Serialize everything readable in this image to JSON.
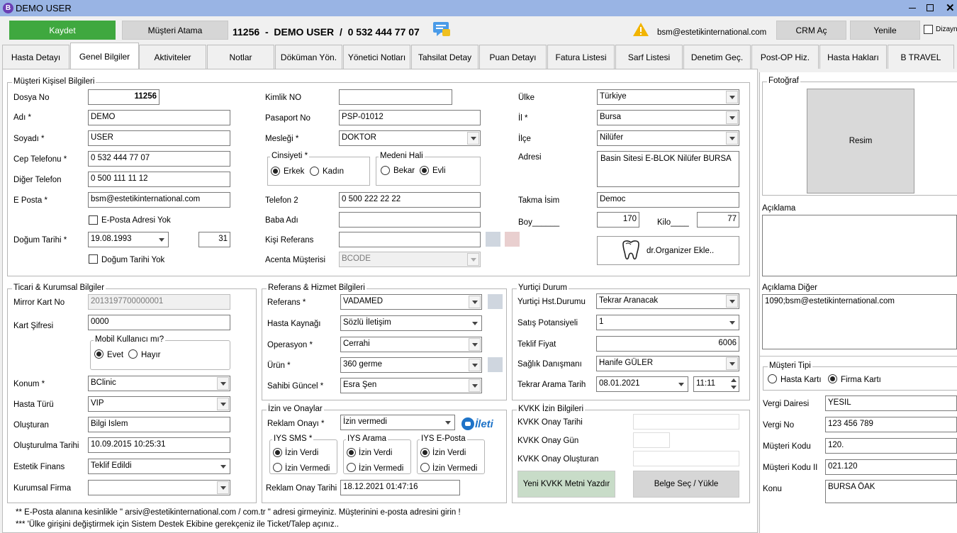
{
  "window": {
    "title": "DEMO USER"
  },
  "toolbar": {
    "save": "Kaydet",
    "assign": "Müşteri Atama",
    "patient_info": "11256  -  DEMO USER  /  0 532 444 77 07",
    "email": "bsm@estetikinternational.com",
    "crm": "CRM Aç",
    "refresh": "Yenile",
    "design": "Dizayn"
  },
  "tabs": [
    "Hasta Detayı",
    "Genel Bilgiler",
    "Aktiviteler",
    "Notlar",
    "Döküman Yön.",
    "Yönetici Notları",
    "Tahsilat Detay",
    "Puan Detayı",
    "Fatura Listesi",
    "Sarf Listesi",
    "Denetim Geç.",
    "Post-OP Hiz.",
    "Hasta Hakları",
    "B TRAVEL"
  ],
  "personal": {
    "legend": "Müşteri Kişisel Bilgileri",
    "dosya_label": "Dosya No",
    "dosya": "11256",
    "adi_label": "Adı *",
    "adi": "DEMO",
    "soyadi_label": "Soyadı *",
    "soyadi": "USER",
    "cep_label": "Cep Telefonu *",
    "cep": "0 532 444 77 07",
    "diger_label": "Diğer Telefon",
    "diger": "0 500 111 11 12",
    "eposta_label": "E Posta *",
    "eposta": "bsm@estetikinternational.com",
    "eposta_yok": "E-Posta Adresi Yok",
    "dogum_label": "Doğum Tarihi *",
    "dogum": "19.08.1993",
    "yas": "31",
    "dogum_yok": "Doğum Tarihi Yok",
    "kimlik_label": "Kimlik NO",
    "kimlik": "",
    "pasaport_label": "Pasaport No",
    "pasaport": "PSP-01012",
    "meslek_label": "Mesleği *",
    "meslek": "DOKTOR",
    "cinsiyet_legend": "Cinsiyeti  *",
    "erkek": "Erkek",
    "kadin": "Kadın",
    "medeni_legend": "Medeni Hali",
    "bekar": "Bekar",
    "evli": "Evli",
    "telefon2_label": "Telefon 2",
    "telefon2": "0 500 222 22 22",
    "baba_label": "Baba Adı",
    "baba": "",
    "kisiref_label": "Kişi Referans",
    "kisiref": "",
    "acenta_label": "Acenta Müşterisi",
    "acenta": "BCODE",
    "ulke_label": "Ülke",
    "ulke": "Türkiye",
    "il_label": "İl *",
    "il": "Bursa",
    "ilce_label": "İlçe",
    "ilce": "Nilüfer",
    "adres_label": "Adresi",
    "adres": "Basin Sitesi E-BLOK Nilüfer BURSA",
    "takma_label": "Takma İsim",
    "takma": "Democ",
    "boy_label": "Boy______",
    "boy": "170",
    "kilo_label": "Kilo____",
    "kilo": "77",
    "organizer": "dr.Organizer Ekle.."
  },
  "ticari": {
    "legend": "Ticari & Kurumsal Bilgiler",
    "mirror_label": "Mirror Kart No",
    "mirror": "2013197700000001",
    "sifre_label": "Kart Şifresi",
    "sifre": "0000",
    "mobil_legend": "Mobil Kullanıcı mı?",
    "evet": "Evet",
    "hayir": "Hayır",
    "konum_label": "Konum *",
    "konum": "BClinic",
    "tur_label": "Hasta Türü",
    "tur": "VIP",
    "olusturan_label": "Oluşturan",
    "olusturan": "Bilgi Islem",
    "tarih_label": "Oluşturulma Tarihi",
    "tarih": "10.09.2015 10:25:31",
    "finans_label": "Estetik Finans",
    "finans": "Teklif Edildi",
    "firma_label": "Kurumsal Firma",
    "firma": ""
  },
  "referans": {
    "legend": "Referans  & Hizmet Bilgileri",
    "ref_label": "Referans *",
    "ref": "VADAMED",
    "kaynak_label": "Hasta Kaynağı",
    "kaynak": "Sözlü İletişim",
    "op_label": "Operasyon *",
    "op": "Cerrahi",
    "urun_label": "Ürün *",
    "urun": "360 germe",
    "sahibi_label": "Sahibi Güncel *",
    "sahibi": "Esra Şen"
  },
  "yurtici": {
    "legend": "Yurtiçi Durum",
    "hst_label": "Yurtiçi Hst.Durumu",
    "hst": "Tekrar Aranacak",
    "pot_label": "Satış Potansiyeli",
    "pot": "1",
    "fiyat_label": "Teklif Fiyat",
    "fiyat": "6006",
    "dan_label": "Sağlık Danışmanı",
    "dan": "Hanife GÜLER",
    "arama_label": "Tekrar Arama Tarih",
    "arama_date": "08.01.2021",
    "arama_time": "11:11"
  },
  "izin": {
    "legend": "İzin ve Onaylar",
    "reklam_label": "Reklam Onayı *",
    "reklam": "İzin vermedi",
    "ileti": "İleti",
    "sms_legend": "IYS SMS *",
    "arama_legend": "IYS Arama",
    "eposta_legend": "IYS E-Posta",
    "verdi": "İzin Verdi",
    "vermedi": "İzin Vermedi",
    "tarih_label": "Reklam Onay Tarihi",
    "tarih": "18.12.2021 01:47:16"
  },
  "kvkk": {
    "legend": "KVKK İzin Bilgileri",
    "tarih_label": "KVKK Onay Tarihi",
    "gun_label": "KVKK Onay Gün",
    "olusturan_label": "KVKK Onay Oluşturan",
    "yeni_btn": "Yeni KVKK Metni Yazdır",
    "belge_btn": "Belge Seç / Yükle"
  },
  "right": {
    "foto_legend": "Fotoğraf",
    "resim": "Resim",
    "aciklama": "Açıklama",
    "aciklama_diger": "Açıklama Diğer",
    "aciklama_diger_val": "1090;bsm@estetikinternational.com",
    "tip_legend": "Müşteri Tipi",
    "hasta_karti": "Hasta Kartı",
    "firma_karti": "Firma Kartı",
    "vd_label": "Vergi Dairesi",
    "vd": "YESIL",
    "vn_label": "Vergi No",
    "vn": "123 456 789",
    "kod_label": "Müşteri Kodu",
    "kod": "120.",
    "kod2_label": "Müşteri Kodu II",
    "kod2": "021.120",
    "konu_label": "Konu",
    "konu": "BURSA ÖAK"
  },
  "notes": [
    "** E-Posta alanına kesinlikle \" arsiv@estetikinternational.com / com.tr \" adresi girmeyiniz. Müşterinini e-posta adresini girin !",
    "*** 'Ülke girişini değiştirmek için Sistem Destek Ekibine gerekçeniz ile Ticket/Talep açınız.."
  ]
}
